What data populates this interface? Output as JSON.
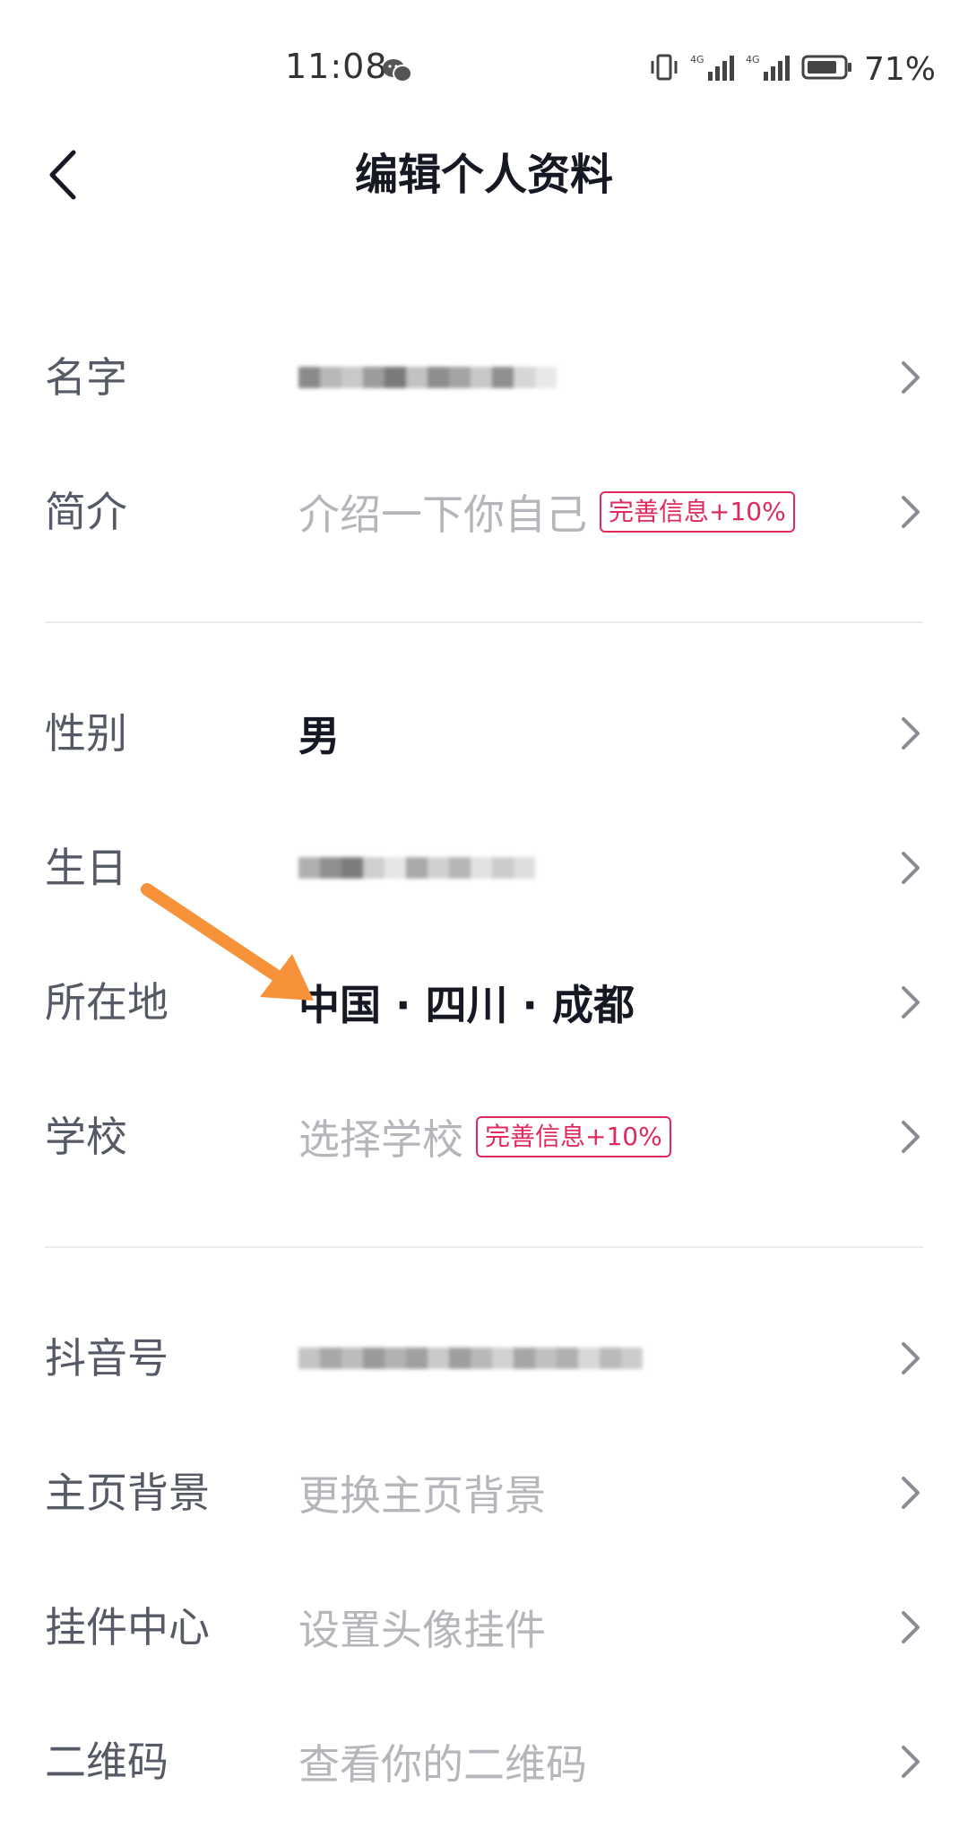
{
  "status_bar": {
    "time": "11:08",
    "battery": "71%",
    "network_1": "4G",
    "network_2": "4G"
  },
  "header": {
    "title": "编辑个人资料"
  },
  "rows": {
    "name": {
      "label": "名字"
    },
    "bio": {
      "label": "简介",
      "placeholder": "介绍一下你自己",
      "tag": "完善信息+10%"
    },
    "gender": {
      "label": "性别",
      "value": "男"
    },
    "birthday": {
      "label": "生日"
    },
    "location": {
      "label": "所在地",
      "value": "中国 · 四川 · 成都"
    },
    "school": {
      "label": "学校",
      "placeholder": "选择学校",
      "tag": "完善信息+10%"
    },
    "douyin_id": {
      "label": "抖音号"
    },
    "background": {
      "label": "主页背景",
      "placeholder": "更换主页背景"
    },
    "pendant": {
      "label": "挂件中心",
      "placeholder": "设置头像挂件"
    },
    "qrcode": {
      "label": "二维码",
      "placeholder": "查看你的二维码"
    }
  },
  "colors": {
    "accent_tag": "#e0295c",
    "annotation_arrow": "#f7923a",
    "label": "#555a66",
    "muted": "#b4b6bb"
  }
}
